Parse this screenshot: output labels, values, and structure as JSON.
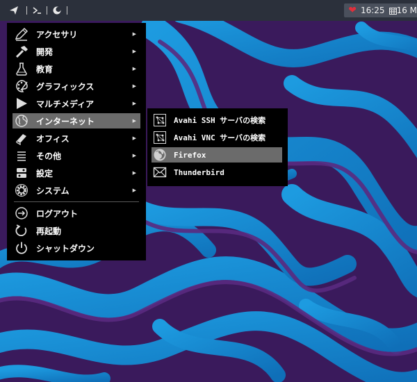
{
  "panel": {
    "launcher_icon": "paper-plane-icon",
    "terminal_icon": "terminal-prompt-icon",
    "moon_icon": "moon-icon",
    "tray_heart_icon": "heart-icon",
    "clock": "16:25",
    "calendar_icon": "calendar-icon",
    "date": "16 M"
  },
  "main_menu": {
    "items": [
      {
        "label": "アクセサリ",
        "icon": "accessories-pen-icon",
        "has_submenu": true
      },
      {
        "label": "開発",
        "icon": "hammer-icon",
        "has_submenu": true
      },
      {
        "label": "教育",
        "icon": "flask-icon",
        "has_submenu": true
      },
      {
        "label": "グラフィックス",
        "icon": "palette-icon",
        "has_submenu": true
      },
      {
        "label": "マルチメディア",
        "icon": "play-icon",
        "has_submenu": true
      },
      {
        "label": "インターネット",
        "icon": "globe-icon",
        "has_submenu": true,
        "selected": true
      },
      {
        "label": "オフィス",
        "icon": "book-icon",
        "has_submenu": true
      },
      {
        "label": "その他",
        "icon": "list-icon",
        "has_submenu": true
      },
      {
        "label": "設定",
        "icon": "settings-toggle-icon",
        "has_submenu": true
      },
      {
        "label": "システム",
        "icon": "gear-icon",
        "has_submenu": true
      }
    ],
    "session": [
      {
        "label": "ログアウト",
        "icon": "logout-icon"
      },
      {
        "label": "再起動",
        "icon": "restart-icon"
      },
      {
        "label": "シャットダウン",
        "icon": "power-icon"
      }
    ],
    "arrow": "▶"
  },
  "internet_submenu": {
    "items": [
      {
        "label": "Avahi SSH サーバの検索",
        "icon": "network-icon"
      },
      {
        "label": "Avahi VNC サーバの検索",
        "icon": "network-icon"
      },
      {
        "label": "Firefox",
        "icon": "firefox-icon",
        "selected": true
      },
      {
        "label": "Thunderbird",
        "icon": "envelope-icon"
      }
    ]
  },
  "colors": {
    "panel": "#2b303b",
    "menu_bg": "#000000",
    "selection": "#6b6b6b",
    "wallpaper_blue": "#1e8fd6",
    "wallpaper_purple": "#3a1a5c"
  }
}
